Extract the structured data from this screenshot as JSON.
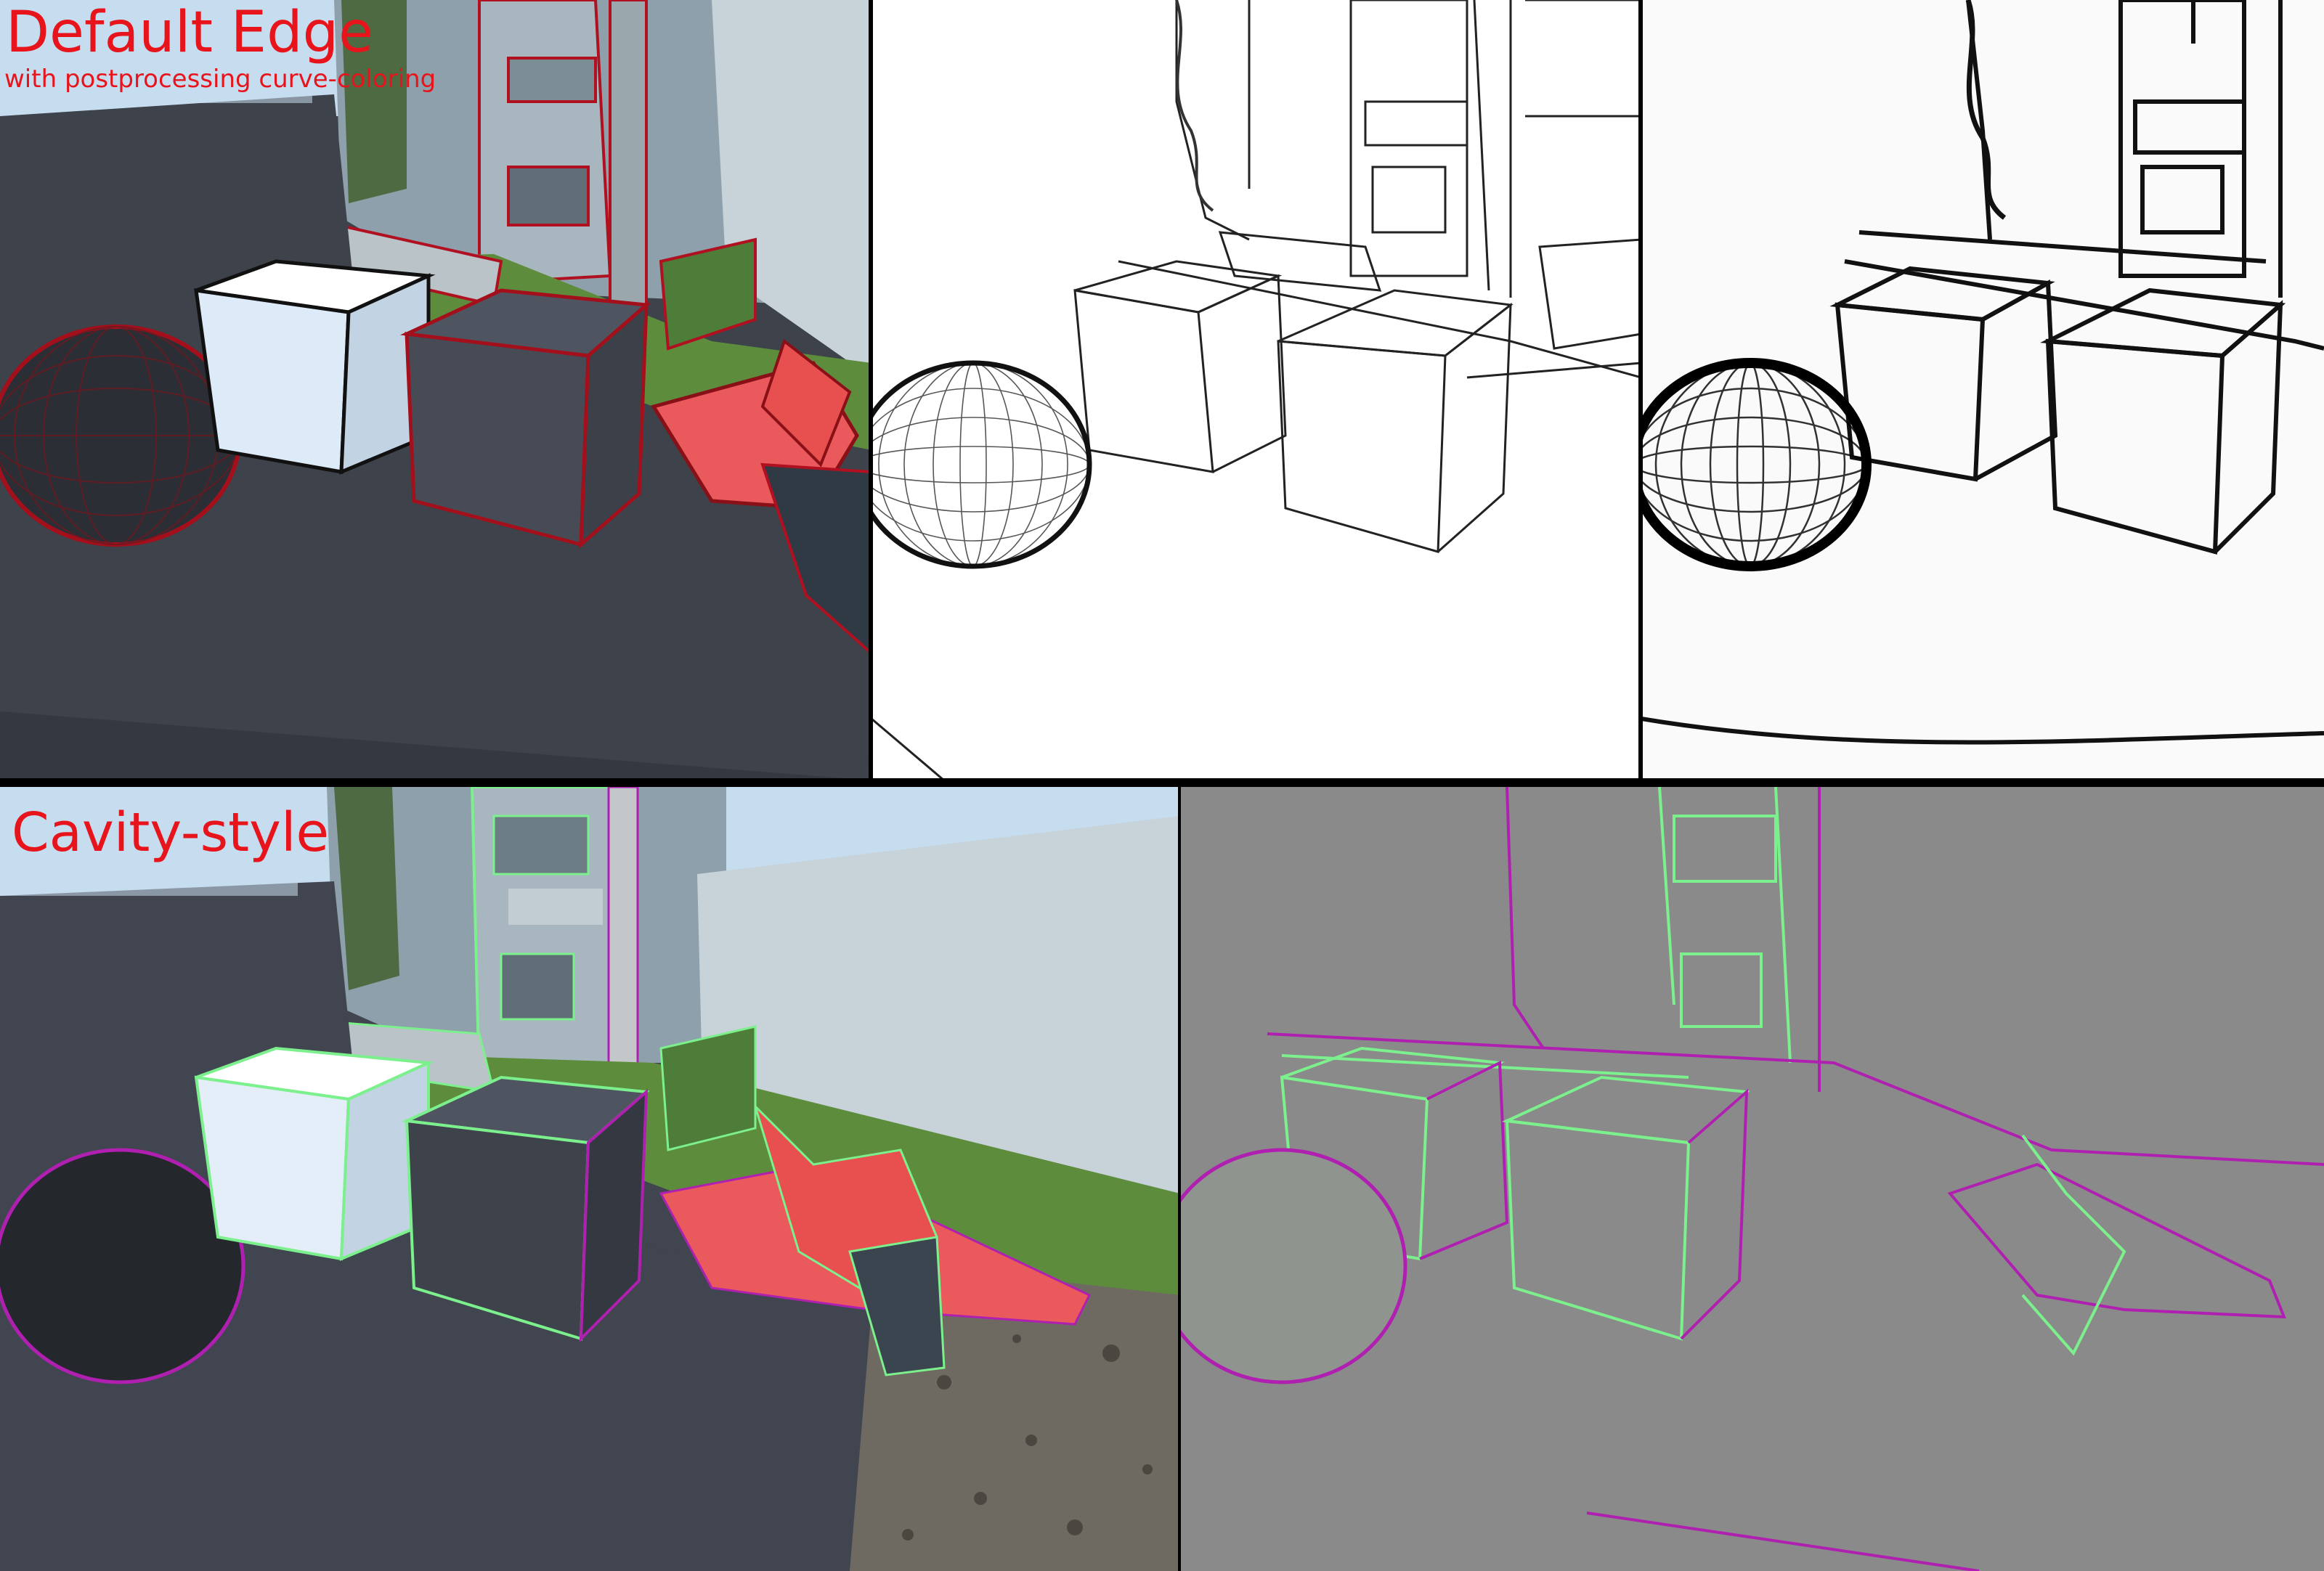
{
  "top_panel": {
    "title": "Default Edge",
    "subtitle": "with postprocessing curve-coloring",
    "views": [
      "colored-render-red-edges",
      "thin-line-edge-render",
      "thick-line-edge-render"
    ]
  },
  "bottom_panel": {
    "title": "Cavity-style",
    "views": [
      "colored-render-cavity",
      "cavity-mask-render"
    ]
  },
  "colors": {
    "label": "#e8141c",
    "edge_red": "#b01020",
    "cavity_green": "#7cf08c",
    "cavity_magenta": "#b020b0",
    "floor": "#40454f",
    "sky": "#bcd6ec",
    "divider": "#000000",
    "mask_bg": "#8a8a8a"
  }
}
